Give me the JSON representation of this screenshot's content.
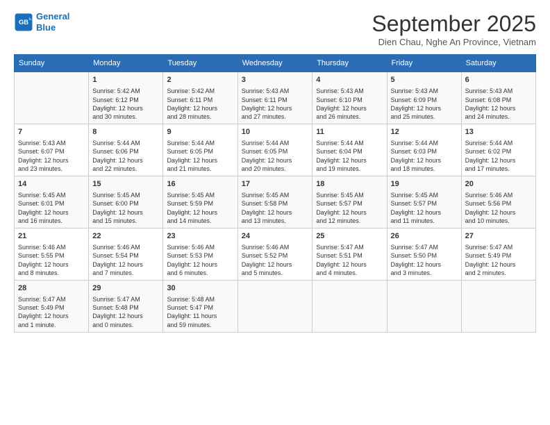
{
  "header": {
    "logo_line1": "General",
    "logo_line2": "Blue",
    "month": "September 2025",
    "location": "Dien Chau, Nghe An Province, Vietnam"
  },
  "days_of_week": [
    "Sunday",
    "Monday",
    "Tuesday",
    "Wednesday",
    "Thursday",
    "Friday",
    "Saturday"
  ],
  "weeks": [
    [
      {
        "day": "",
        "info": ""
      },
      {
        "day": "1",
        "info": "Sunrise: 5:42 AM\nSunset: 6:12 PM\nDaylight: 12 hours\nand 30 minutes."
      },
      {
        "day": "2",
        "info": "Sunrise: 5:42 AM\nSunset: 6:11 PM\nDaylight: 12 hours\nand 28 minutes."
      },
      {
        "day": "3",
        "info": "Sunrise: 5:43 AM\nSunset: 6:11 PM\nDaylight: 12 hours\nand 27 minutes."
      },
      {
        "day": "4",
        "info": "Sunrise: 5:43 AM\nSunset: 6:10 PM\nDaylight: 12 hours\nand 26 minutes."
      },
      {
        "day": "5",
        "info": "Sunrise: 5:43 AM\nSunset: 6:09 PM\nDaylight: 12 hours\nand 25 minutes."
      },
      {
        "day": "6",
        "info": "Sunrise: 5:43 AM\nSunset: 6:08 PM\nDaylight: 12 hours\nand 24 minutes."
      }
    ],
    [
      {
        "day": "7",
        "info": "Sunrise: 5:43 AM\nSunset: 6:07 PM\nDaylight: 12 hours\nand 23 minutes."
      },
      {
        "day": "8",
        "info": "Sunrise: 5:44 AM\nSunset: 6:06 PM\nDaylight: 12 hours\nand 22 minutes."
      },
      {
        "day": "9",
        "info": "Sunrise: 5:44 AM\nSunset: 6:05 PM\nDaylight: 12 hours\nand 21 minutes."
      },
      {
        "day": "10",
        "info": "Sunrise: 5:44 AM\nSunset: 6:05 PM\nDaylight: 12 hours\nand 20 minutes."
      },
      {
        "day": "11",
        "info": "Sunrise: 5:44 AM\nSunset: 6:04 PM\nDaylight: 12 hours\nand 19 minutes."
      },
      {
        "day": "12",
        "info": "Sunrise: 5:44 AM\nSunset: 6:03 PM\nDaylight: 12 hours\nand 18 minutes."
      },
      {
        "day": "13",
        "info": "Sunrise: 5:44 AM\nSunset: 6:02 PM\nDaylight: 12 hours\nand 17 minutes."
      }
    ],
    [
      {
        "day": "14",
        "info": "Sunrise: 5:45 AM\nSunset: 6:01 PM\nDaylight: 12 hours\nand 16 minutes."
      },
      {
        "day": "15",
        "info": "Sunrise: 5:45 AM\nSunset: 6:00 PM\nDaylight: 12 hours\nand 15 minutes."
      },
      {
        "day": "16",
        "info": "Sunrise: 5:45 AM\nSunset: 5:59 PM\nDaylight: 12 hours\nand 14 minutes."
      },
      {
        "day": "17",
        "info": "Sunrise: 5:45 AM\nSunset: 5:58 PM\nDaylight: 12 hours\nand 13 minutes."
      },
      {
        "day": "18",
        "info": "Sunrise: 5:45 AM\nSunset: 5:57 PM\nDaylight: 12 hours\nand 12 minutes."
      },
      {
        "day": "19",
        "info": "Sunrise: 5:45 AM\nSunset: 5:57 PM\nDaylight: 12 hours\nand 11 minutes."
      },
      {
        "day": "20",
        "info": "Sunrise: 5:46 AM\nSunset: 5:56 PM\nDaylight: 12 hours\nand 10 minutes."
      }
    ],
    [
      {
        "day": "21",
        "info": "Sunrise: 5:46 AM\nSunset: 5:55 PM\nDaylight: 12 hours\nand 8 minutes."
      },
      {
        "day": "22",
        "info": "Sunrise: 5:46 AM\nSunset: 5:54 PM\nDaylight: 12 hours\nand 7 minutes."
      },
      {
        "day": "23",
        "info": "Sunrise: 5:46 AM\nSunset: 5:53 PM\nDaylight: 12 hours\nand 6 minutes."
      },
      {
        "day": "24",
        "info": "Sunrise: 5:46 AM\nSunset: 5:52 PM\nDaylight: 12 hours\nand 5 minutes."
      },
      {
        "day": "25",
        "info": "Sunrise: 5:47 AM\nSunset: 5:51 PM\nDaylight: 12 hours\nand 4 minutes."
      },
      {
        "day": "26",
        "info": "Sunrise: 5:47 AM\nSunset: 5:50 PM\nDaylight: 12 hours\nand 3 minutes."
      },
      {
        "day": "27",
        "info": "Sunrise: 5:47 AM\nSunset: 5:49 PM\nDaylight: 12 hours\nand 2 minutes."
      }
    ],
    [
      {
        "day": "28",
        "info": "Sunrise: 5:47 AM\nSunset: 5:49 PM\nDaylight: 12 hours\nand 1 minute."
      },
      {
        "day": "29",
        "info": "Sunrise: 5:47 AM\nSunset: 5:48 PM\nDaylight: 12 hours\nand 0 minutes."
      },
      {
        "day": "30",
        "info": "Sunrise: 5:48 AM\nSunset: 5:47 PM\nDaylight: 11 hours\nand 59 minutes."
      },
      {
        "day": "",
        "info": ""
      },
      {
        "day": "",
        "info": ""
      },
      {
        "day": "",
        "info": ""
      },
      {
        "day": "",
        "info": ""
      }
    ]
  ]
}
